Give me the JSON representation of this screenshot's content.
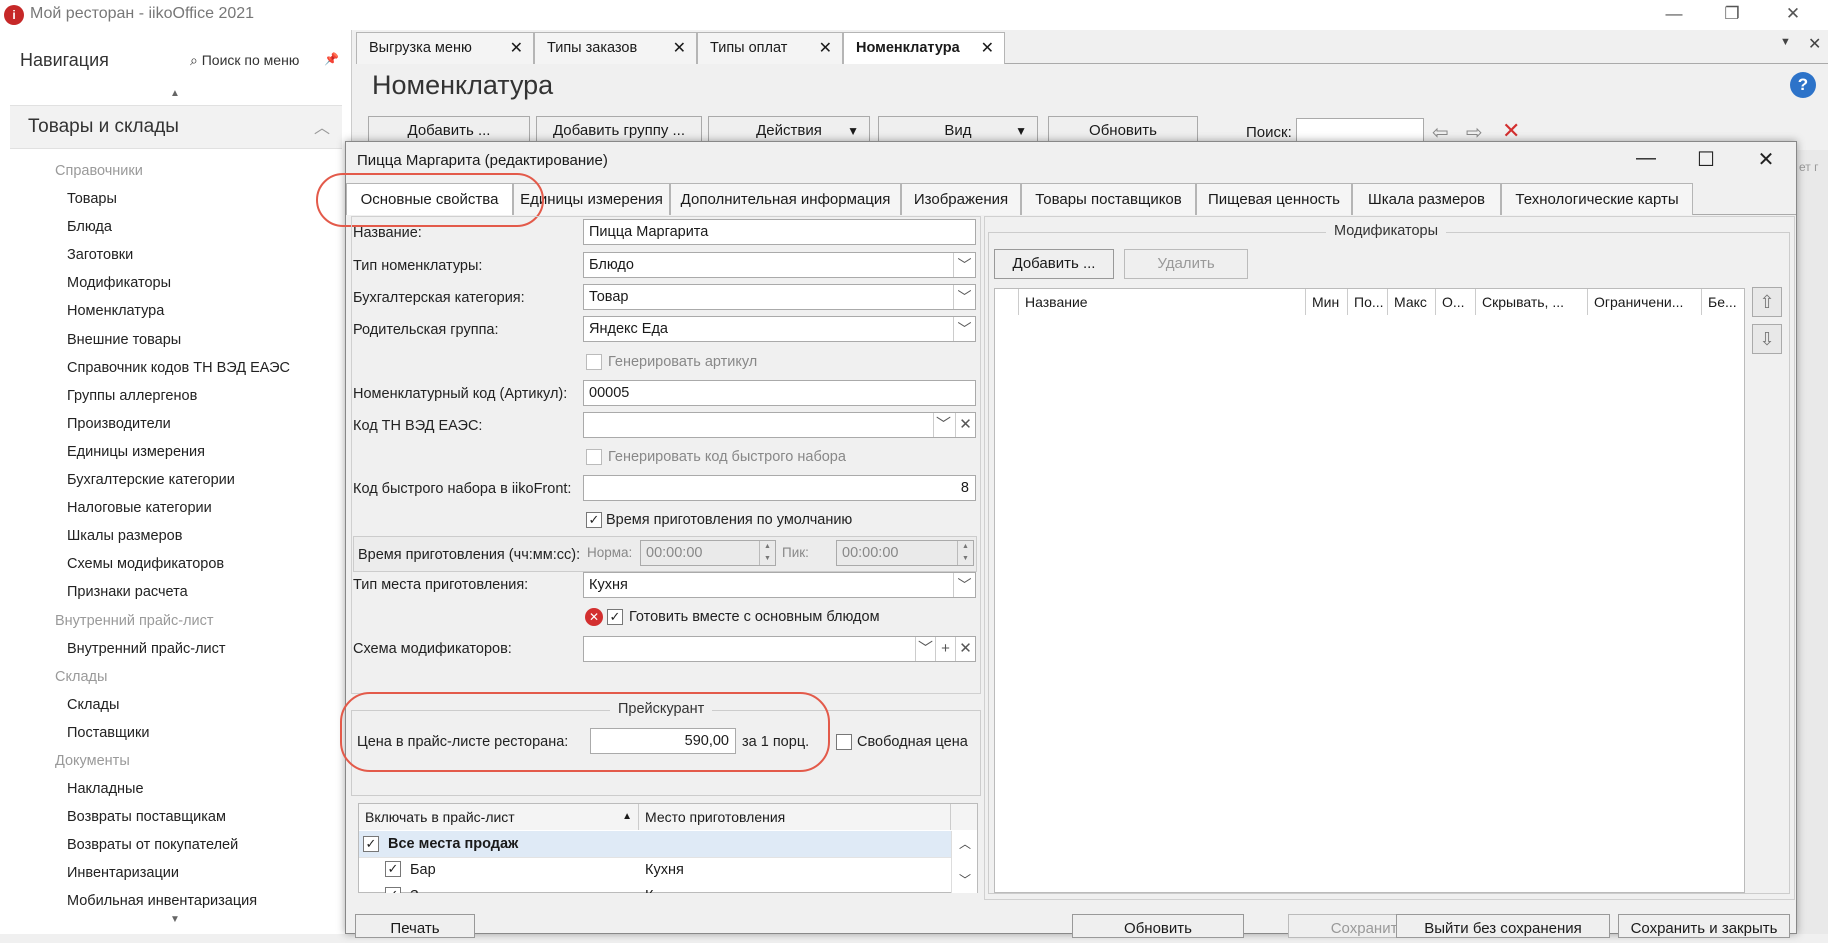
{
  "window": {
    "title": "Мой ресторан - iikoOffice 2021",
    "icon": "iiko-app-icon"
  },
  "nav": {
    "title": "Навигация",
    "search": "Поиск по меню",
    "section": "Товары и склады",
    "items": [
      {
        "label": "Справочники",
        "header": true
      },
      {
        "label": "Товары"
      },
      {
        "label": "Блюда"
      },
      {
        "label": "Заготовки"
      },
      {
        "label": "Модификаторы"
      },
      {
        "label": "Номенклатура"
      },
      {
        "label": "Внешние товары"
      },
      {
        "label": "Справочник кодов ТН ВЭД ЕАЭС"
      },
      {
        "label": "Группы аллергенов"
      },
      {
        "label": "Производители"
      },
      {
        "label": "Единицы измерения"
      },
      {
        "label": "Бухгалтерские категории"
      },
      {
        "label": "Налоговые категории"
      },
      {
        "label": "Шкалы размеров"
      },
      {
        "label": "Схемы модификаторов"
      },
      {
        "label": "Признаки расчета"
      },
      {
        "label": "Внутренний прайс-лист",
        "header": true
      },
      {
        "label": "Внутренний прайс-лист"
      },
      {
        "label": "Склады",
        "header": true
      },
      {
        "label": "Склады"
      },
      {
        "label": "Поставщики"
      },
      {
        "label": "Документы",
        "header": true
      },
      {
        "label": "Накладные"
      },
      {
        "label": "Возвраты поставщикам"
      },
      {
        "label": "Возвраты от покупателей"
      },
      {
        "label": "Инвентаризации"
      },
      {
        "label": "Мобильная инвентаризация"
      }
    ]
  },
  "doc_tabs": [
    {
      "label": "Выгрузка меню"
    },
    {
      "label": "Типы заказов"
    },
    {
      "label": "Типы оплат"
    },
    {
      "label": "Номенклатура",
      "active": true
    }
  ],
  "page": {
    "title": "Номенклатура",
    "toolbar": {
      "add": "Добавить ...",
      "add_group": "Добавить группу ...",
      "actions": "Действия",
      "view": "Вид",
      "refresh": "Обновить",
      "search_label": "Поиск:",
      "search_value": ""
    }
  },
  "right_gutter": [
    "ет г"
  ],
  "dialog": {
    "title": "Пицца Маргарита (редактирование)",
    "tabs": [
      {
        "label": "Основные свойства",
        "active": true
      },
      {
        "label": "Единицы измерения"
      },
      {
        "label": "Дополнительная информация"
      },
      {
        "label": "Изображения"
      },
      {
        "label": "Товары поставщиков"
      },
      {
        "label": "Пищевая ценность"
      },
      {
        "label": "Шкала размеров"
      },
      {
        "label": "Технологические карты"
      }
    ],
    "form": {
      "name_label": "Название:",
      "name_value": "Пицца Маргарита",
      "type_label": "Тип номенклатуры:",
      "type_value": "Блюдо",
      "acc_label": "Бухгалтерская категория:",
      "acc_value": "Товар",
      "parent_label": "Родительская группа:",
      "parent_value": "Яндекс Еда",
      "gen_article": "Генерировать артикул",
      "code_label": "Номенклатурный код (Артикул):",
      "code_value": "00005",
      "tnved_label": "Код ТН ВЭД ЕАЭС:",
      "tnved_value": "",
      "gen_fast": "Генерировать код быстрого набора",
      "fast_label": "Код быстрого набора в iikoFront:",
      "fast_value": "8",
      "default_time": "Время приготовления по умолчанию",
      "cook_time_label": "Время приготовления (чч:мм:сс):",
      "norm_label": "Норма:",
      "norm_value": "00:00:00",
      "peak_label": "Пик:",
      "peak_value": "00:00:00",
      "place_label": "Тип места приготовления:",
      "place_value": "Кухня",
      "cook_together": "Готовить вместе с основным блюдом",
      "scheme_label": "Схема модификаторов:",
      "scheme_value": ""
    },
    "price": {
      "group_title": "Прейскурант",
      "price_label": "Цена в прайс-листе ресторана:",
      "price_value": "590,00",
      "per": "за 1 порц.",
      "free_price": "Свободная цена"
    },
    "grid": {
      "headers": [
        "Включать в прайс-лист",
        "Место приготовления"
      ],
      "rows": [
        {
          "name": "Все места продаж",
          "place": "",
          "bold": true
        },
        {
          "name": "Бар",
          "place": "Кухня"
        },
        {
          "name": "З",
          "place": "К"
        }
      ]
    },
    "modifiers": {
      "title": "Модификаторы",
      "add": "Добавить ...",
      "delete": "Удалить",
      "headers": [
        "Название",
        "Мин",
        "По...",
        "Макс",
        "О...",
        "Скрывать, ...",
        "Ограничени...",
        "Бе..."
      ]
    },
    "footer": {
      "print": "Печать",
      "refresh": "Обновить",
      "save": "Сохранить",
      "exit": "Выйти без сохранения",
      "save_close": "Сохранить и закрыть"
    }
  },
  "colors": {
    "highlight": "#e35a4a",
    "accent": "#2d73c9",
    "error": "#d32f2f"
  }
}
